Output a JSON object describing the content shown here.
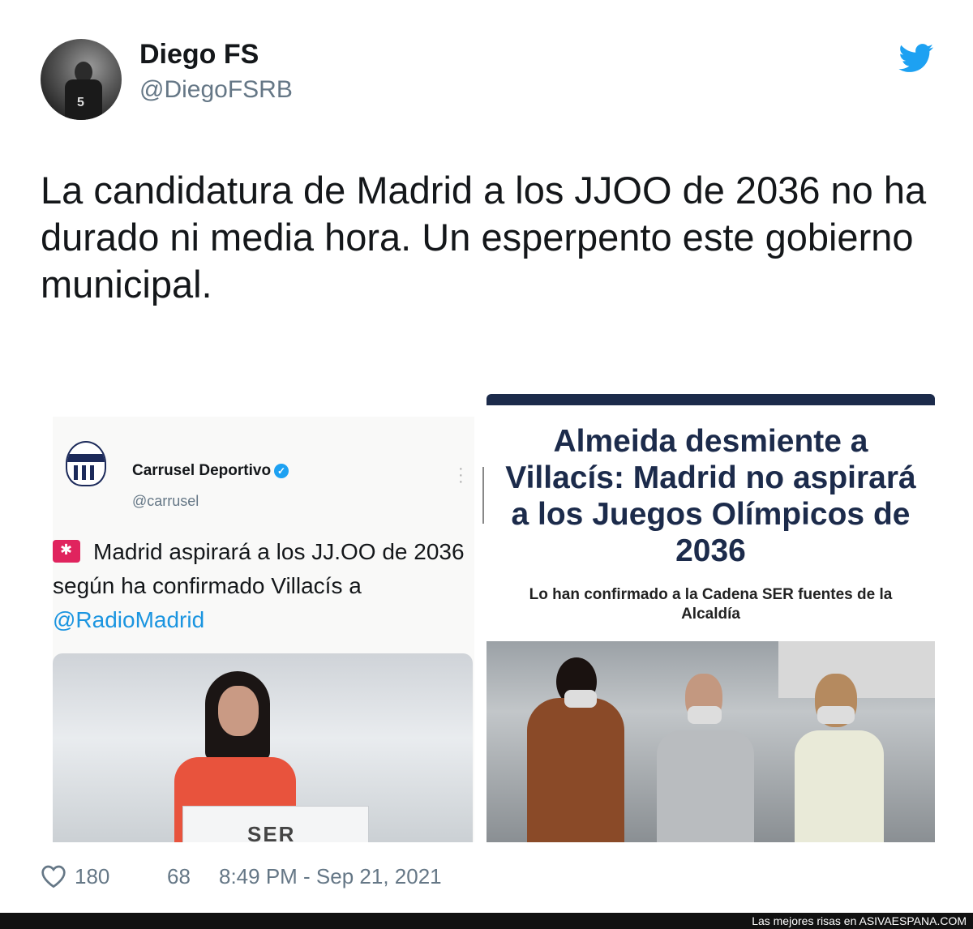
{
  "tweet": {
    "display_name": "Diego FS",
    "handle": "@DiegoFSRB",
    "text": "La candidatura de Madrid a los JJOO de 2036 no ha durado ni media hora. Un esperpento este gobierno municipal.",
    "likes": "180",
    "retweets": "68",
    "timestamp": "8:49 PM - Sep 21, 2021"
  },
  "embedded_left": {
    "name": "Carrusel Deportivo",
    "handle": "@carrusel",
    "text_main": "Madrid aspirará a los JJ.OO de 2036 según ha confirmado Villacís a ",
    "mention": "@RadioMadrid",
    "photo_logo": "SER"
  },
  "embedded_right": {
    "headline": "Almeida desmiente a Villacís: Madrid no aspirará a los Juegos Olímpicos de 2036",
    "subhead": "Lo han confirmado a la Cadena SER fuentes de la Alcaldía"
  },
  "watermark": {
    "prefix": "Las mejores risas en",
    "site": "ASIVAESPANA.COM"
  },
  "colors": {
    "twitter_blue": "#1da1f2",
    "text_primary": "#14171a",
    "text_secondary": "#657786",
    "headline_navy": "#1c2b4b"
  },
  "icons": [
    "twitter-bird-icon",
    "heart-icon",
    "verified-icon",
    "siren-icon",
    "more-dots-icon"
  ]
}
